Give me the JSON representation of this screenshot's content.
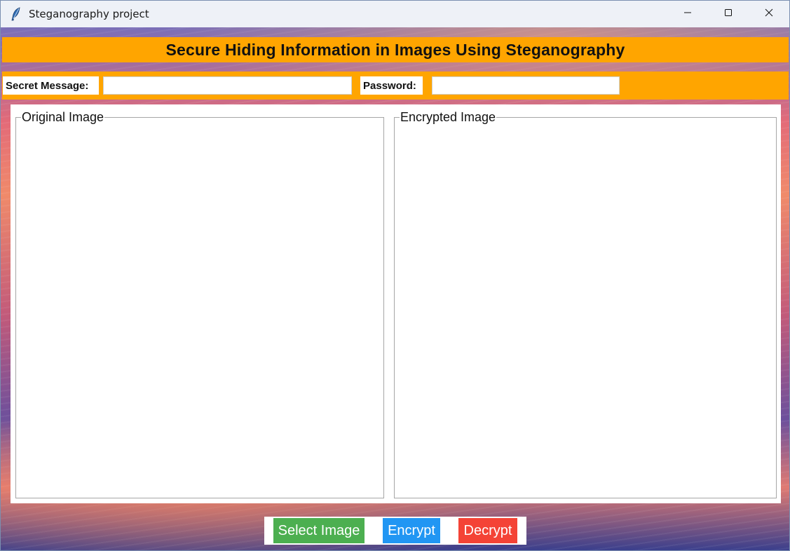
{
  "window": {
    "title": "Steganography project",
    "icon": "feather-icon",
    "controls": {
      "minimize": "minimize-icon",
      "maximize": "maximize-icon",
      "close": "close-icon"
    }
  },
  "header": {
    "title": "Secure Hiding Information in Images Using Steganography",
    "background": "#ffa500"
  },
  "form": {
    "secret_label": "Secret Message:",
    "secret_value": "",
    "password_label": "Password:",
    "password_value": ""
  },
  "panels": {
    "original_label": "Original Image",
    "encrypted_label": "Encrypted Image"
  },
  "buttons": {
    "select_image": "Select Image",
    "encrypt": "Encrypt",
    "decrypt": "Decrypt",
    "colors": {
      "select_image": "#4caf50",
      "encrypt": "#2196f3",
      "decrypt": "#f44336"
    }
  }
}
